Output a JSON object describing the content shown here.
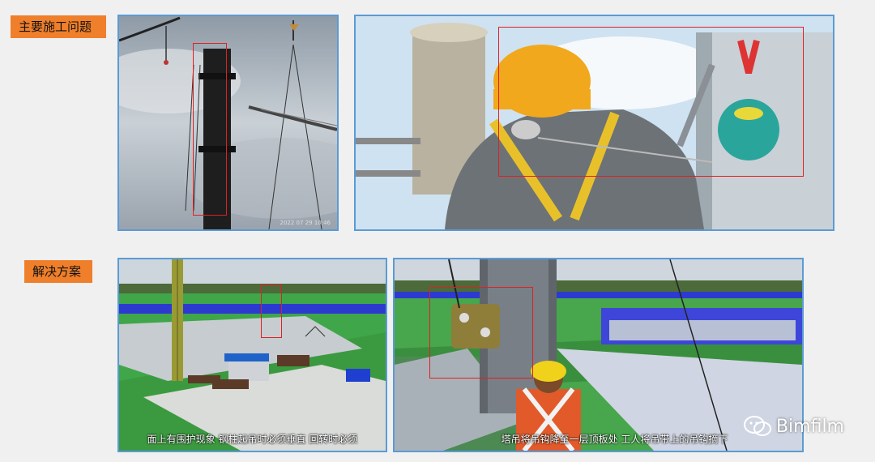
{
  "sections": {
    "problems_label": "主要施工问题",
    "solutions_label": "解决方案"
  },
  "panels": {
    "problem_1": {
      "timestamp": "2022 07 29 10:46"
    },
    "solution_1": {
      "caption": "面上有围护现象 钢柱起吊时必须垂直 回转时必须"
    },
    "solution_2": {
      "caption": "塔吊将吊钩降至一层顶板处 工人将吊带上的吊钩摘下"
    }
  },
  "watermark": {
    "text": "Bimfilm",
    "icon": "wechat-icon"
  },
  "colors": {
    "tag_bg": "#f07f2b",
    "panel_border": "#5b9bd5",
    "highlight": "#e02020"
  }
}
